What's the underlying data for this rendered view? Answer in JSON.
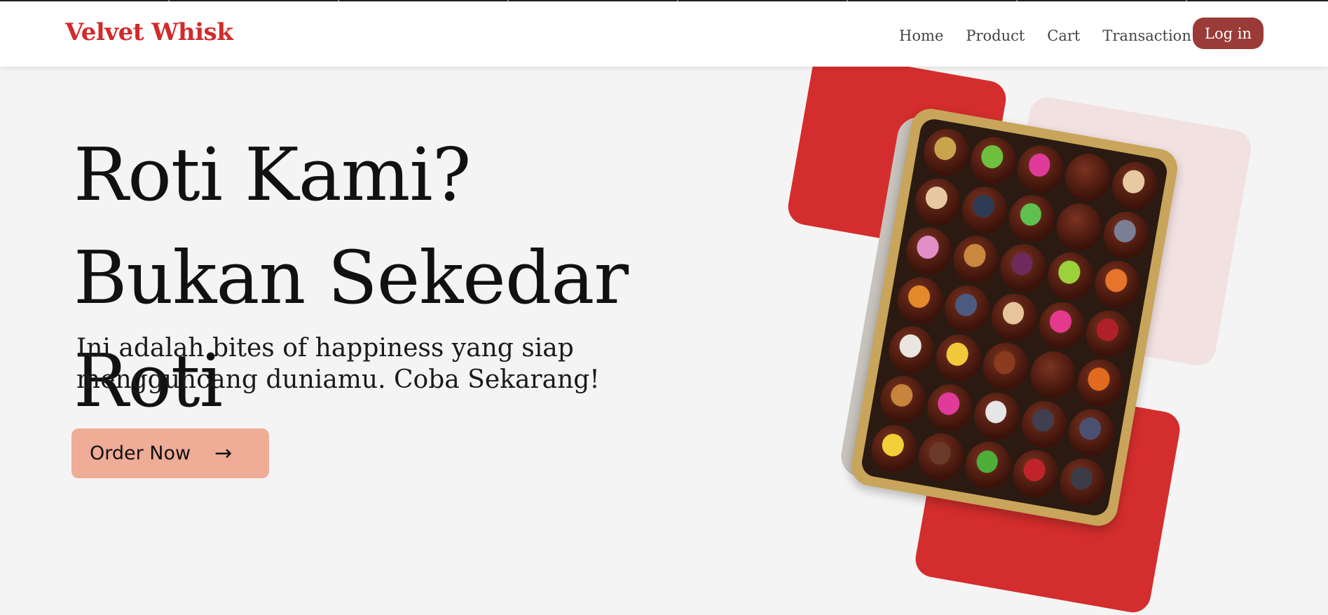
{
  "brand": {
    "name": "Velvet Whisk",
    "color": "#d12b2b"
  },
  "nav": {
    "links": [
      "Home",
      "Product",
      "Cart",
      "Transaction"
    ],
    "login_label": "Log in"
  },
  "hero": {
    "title": "Roti Kami? Bukan Sekedar Roti",
    "subtitle": "Ini adalah bites of happiness yang siap mengguncang duniamu. Coba Sekarang!",
    "cta_label": "Order Now",
    "cta_icon": "arrow-right-icon"
  },
  "colors": {
    "accent_red": "#d42d2d",
    "login_bg": "#9a3b37",
    "cta_bg": "#efac97",
    "pink_panel": "#f2e1e1",
    "page_bg": "#f4f4f4"
  },
  "image": {
    "subject": "product-image-chocolate-dates-tray"
  },
  "tray_toppings": [
    "#c8a44a",
    "#6fbf3f",
    "#e03a9a",
    "",
    "#e7c9a2",
    "#e8c8a0",
    "#2f3b55",
    "#5fbf4f",
    "",
    "#7a7f95",
    "#e08fc6",
    "#c9883f",
    "#6d2a5a",
    "#9bd13b",
    "#e6742a",
    "#e58a2a",
    "#4d5a80",
    "#e8c49a",
    "#e43a8e",
    "#b0202a",
    "#e9e6e0",
    "#f1c93a",
    "#8a3a1e",
    "",
    "#e06a1e",
    "#c6843c",
    "#e03a9a",
    "#e6e6e6",
    "#3f3f4f",
    "#4b5070",
    "#f2d03a",
    "#6a3a2a",
    "#4fae3a",
    "#c0242a",
    "#3c3c48"
  ]
}
